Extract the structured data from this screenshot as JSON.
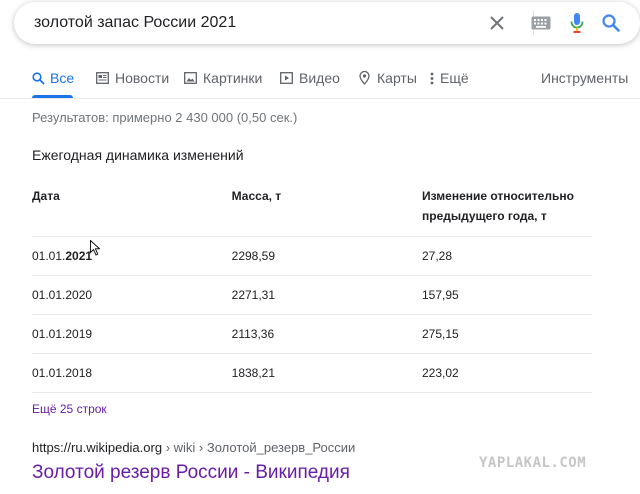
{
  "search": {
    "query": "золотой запас России 2021"
  },
  "tabs": [
    {
      "label": "Все",
      "icon": "search-icon"
    },
    {
      "label": "Новости",
      "icon": "news-icon"
    },
    {
      "label": "Картинки",
      "icon": "image-icon"
    },
    {
      "label": "Видео",
      "icon": "video-icon"
    },
    {
      "label": "Карты",
      "icon": "map-pin-icon"
    },
    {
      "label": "Ещё",
      "icon": "more-vert-icon"
    }
  ],
  "tools_label": "Инструменты",
  "result_stats": "Результатов: примерно 2 430 000 (0,50 сек.)",
  "snippet": {
    "title": "Ежегодная динамика изменений",
    "headers": [
      "Дата",
      "Масса, т",
      "Изменение относительно предыдущего года, т"
    ],
    "rows": [
      {
        "date_prefix": "01.01.",
        "date_bold": "2021",
        "mass": "2298,59",
        "change": "27,28"
      },
      {
        "date_prefix": "01.01.2020",
        "date_bold": "",
        "mass": "2271,31",
        "change": "157,95"
      },
      {
        "date_prefix": "01.01.2019",
        "date_bold": "",
        "mass": "2113,36",
        "change": "275,15"
      },
      {
        "date_prefix": "01.01.2018",
        "date_bold": "",
        "mass": "1838,21",
        "change": "223,02"
      }
    ],
    "more_rows": "Ещё 25 строк"
  },
  "result": {
    "cite_domain": "https://ru.wikipedia.org",
    "cite_path": " › wiki › Золотой_резерв_России",
    "title": "Золотой резерв России - Википедия"
  },
  "watermark": "YAPLAKAL.COM",
  "colors": {
    "accent": "#1a73e8",
    "visited_link": "#681da8",
    "text": "#202124",
    "muted": "#70757a"
  }
}
